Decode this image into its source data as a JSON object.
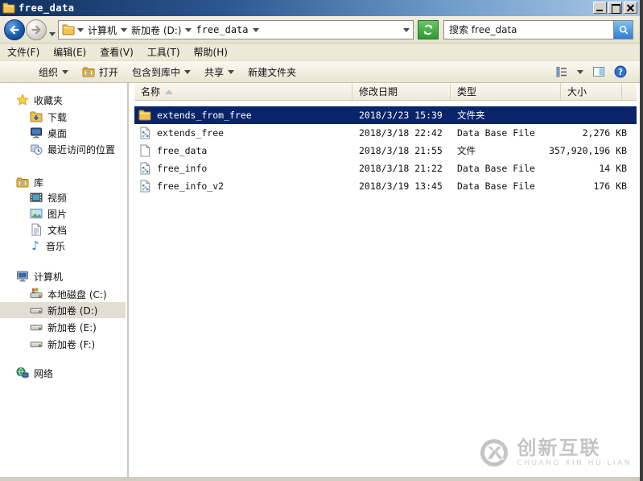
{
  "titlebar": {
    "title": "free_data"
  },
  "nav": {
    "breadcrumbs": [
      "计算机",
      "新加卷 (D:)",
      "free_data"
    ]
  },
  "search": {
    "placeholder": "搜索 free_data"
  },
  "menubar": {
    "items": [
      "文件(F)",
      "编辑(E)",
      "查看(V)",
      "工具(T)",
      "帮助(H)"
    ]
  },
  "toolbar": {
    "organize": "组织",
    "open": "打开",
    "include_in_library": "包含到库中",
    "share": "共享",
    "new_folder": "新建文件夹"
  },
  "columns": {
    "name": "名称",
    "date": "修改日期",
    "type": "类型",
    "size": "大小"
  },
  "sidebar": {
    "sections": [
      {
        "label": "收藏夹",
        "children": [
          "下载",
          "桌面",
          "最近访问的位置"
        ]
      },
      {
        "label": "库",
        "children": [
          "视频",
          "图片",
          "文档",
          "音乐"
        ]
      },
      {
        "label": "计算机",
        "children": [
          "本地磁盘 (C:)",
          "新加卷 (D:)",
          "新加卷 (E:)",
          "新加卷 (F:)"
        ]
      },
      {
        "label": "网络",
        "children": []
      }
    ],
    "selected": "新加卷 (D:)"
  },
  "files": {
    "rows": [
      {
        "name": "extends_from_free",
        "date": "2018/3/23 15:39",
        "type": "文件夹",
        "size": "",
        "icon": "folder-icon",
        "selected": true
      },
      {
        "name": "extends_free",
        "date": "2018/3/18 22:42",
        "type": "Data Base File",
        "size": "2,276 KB",
        "icon": "database-file-icon",
        "selected": false
      },
      {
        "name": "free_data",
        "date": "2018/3/18 21:55",
        "type": "文件",
        "size": "357,920,196 KB",
        "icon": "file-icon",
        "selected": false
      },
      {
        "name": "free_info",
        "date": "2018/3/18 21:22",
        "type": "Data Base File",
        "size": "14 KB",
        "icon": "database-file-icon",
        "selected": false
      },
      {
        "name": "free_info_v2",
        "date": "2018/3/19 13:45",
        "type": "Data Base File",
        "size": "176 KB",
        "icon": "database-file-icon",
        "selected": false
      }
    ]
  },
  "watermark": {
    "title": "创新互联",
    "subtitle": "CHUANG XIN HU LIAN"
  },
  "colors": {
    "selection": "#0a246a",
    "titlebar_left": "#10305e",
    "titlebar_right": "#abc9e8",
    "refresh_green": "#2f9a2f",
    "search_blue": "#2a7fd4",
    "sidebar_highlight": "#e3ded5",
    "watermark_gray": "#c4c4c4"
  }
}
